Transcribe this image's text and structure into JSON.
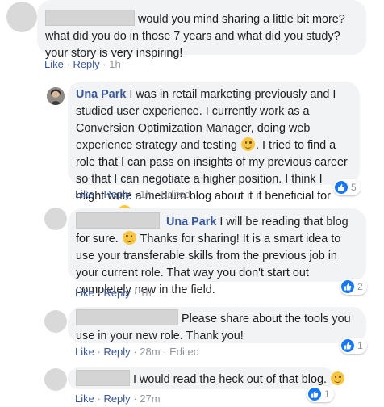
{
  "comments": [
    {
      "text": "would you mind sharing a little bit more? what did you do in those 7 years and what did you study? your story is very inspiring!",
      "actions": {
        "like": "Like",
        "reply": "Reply",
        "time": "1h",
        "edited": ""
      }
    },
    {
      "author": "Una Park",
      "text_a": "I was in retail marketing previously and I studied user experience. I currently work as a Conversion Optimization Manager, doing web experience strategy and testing",
      "text_b": ". I tried to find a role that I can pass on insights of my previous career so that I can negotiate a higher position. I think I might write a medium blog about it if beneficial for anyone",
      "actions": {
        "like": "Like",
        "reply": "Reply",
        "time": "1h",
        "edited": "Edited"
      },
      "likes": "5"
    },
    {
      "mention": "Una Park",
      "text_a": "I will be reading that blog for sure.",
      "text_b": "Thanks for sharing! It is a smart idea to use your transferable skills from the previous job in your current role. That way you don't start out completely new in the field.",
      "actions": {
        "like": "Like",
        "reply": "Reply",
        "time": "1h",
        "edited": ""
      },
      "likes": "2"
    },
    {
      "text": "Please share about the tools you use in your new role. Thank you!",
      "actions": {
        "like": "Like",
        "reply": "Reply",
        "time": "28m",
        "edited": "Edited"
      },
      "likes": "1"
    },
    {
      "text": "I would read the heck out of that blog.",
      "actions": {
        "like": "Like",
        "reply": "Reply",
        "time": "27m",
        "edited": ""
      },
      "likes": "1"
    }
  ],
  "colors": {
    "link": "#385898",
    "bubble": "#f2f3f5",
    "meta": "#90949c",
    "like_blue": "#1877f2"
  },
  "icons": [
    "smile-emoji",
    "tongue-emoji",
    "thumbs-up-icon"
  ]
}
